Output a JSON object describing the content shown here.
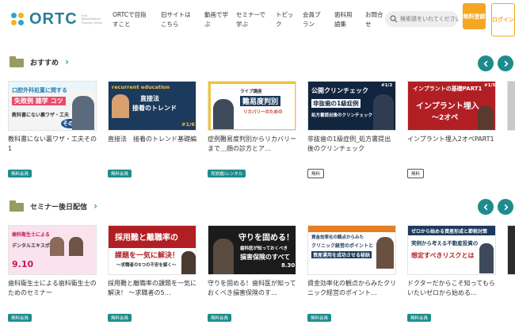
{
  "header": {
    "logo_text": "ORTC",
    "logo_sub": "Oral Rehabilitation Training Center",
    "nav": [
      {
        "label": "ORTCで目指すこと"
      },
      {
        "label": "旧サイトはこちら"
      },
      {
        "label": "動画で学ぶ"
      },
      {
        "label": "セミナーで学ぶ"
      },
      {
        "label": "トピック"
      },
      {
        "label": "会員プラン"
      },
      {
        "label": "歯科用語集"
      },
      {
        "label": "お問合せ"
      }
    ],
    "search_placeholder": "検索語をいれてください",
    "register_label": "無料登録",
    "login_label": "ログイン"
  },
  "sections": [
    {
      "title": "おすすめ",
      "cards": [
        {
          "title": "教科書にない裏ワザ・工夫その1",
          "badge": "無料会員",
          "badge_style": "green",
          "thumb": {
            "line1": "口腔外科処置に関する",
            "line2": "失敗例 雑学 コツ",
            "line3": "教科書にない裏ワザ・工夫",
            "tag": "その1"
          }
        },
        {
          "title": "直接法　接着のトレンド基礎編",
          "badge": "無料会員",
          "badge_style": "green",
          "thumb": {
            "line1": "recurrent education",
            "line2": "直接法",
            "line3": "接着のトレンド",
            "tag": "#1/6"
          }
        },
        {
          "title": "症例難易度判別からリカバリーまで＿顔の診方とア…",
          "badge": "見放題/レンタル",
          "badge_style": "green",
          "thumb": {
            "line1": "ライブ講座",
            "line2": "難易度判別",
            "line3": "リカバリーのための",
            "tag": ""
          }
        },
        {
          "title": "非抜歯の1級症例_処方書提出後のクリンチェック",
          "badge": "無料",
          "badge_style": "outline",
          "thumb": {
            "line1": "公開クリンチェック",
            "line2": "非抜歯の1級症例",
            "line3": "処方書提出後のクリンチェック",
            "tag": "#1/2"
          }
        },
        {
          "title": "インプラント埋入2オペPART1",
          "badge": "無料",
          "badge_style": "outline",
          "thumb": {
            "line1": "インプラントの基礎PART1",
            "line2": "インプラント埋入",
            "line3": "〜2オペ",
            "tag": "#1/5"
          }
        }
      ]
    },
    {
      "title": "セミナー後日配信",
      "cards": [
        {
          "title": "歯科衛生士による歯科衛生士のためのセミナー",
          "badge": "無料会員",
          "badge_style": "green",
          "thumb": {
            "line1": "歯科衛生士による",
            "line2": "デンタルエキスポ",
            "line3": "",
            "tag": "9.10"
          }
        },
        {
          "title": "採用難と離職率の課題を一気に解決！ 〜求職者の5…",
          "badge": "無料会員",
          "badge_style": "green",
          "thumb": {
            "line1": "採用難と離職率の",
            "line2": "課題を一気に解決！",
            "line3": "〜求職者の5つの不安を解く〜",
            "tag": ""
          }
        },
        {
          "title": "守りを固める！歯科医が知っておくべき損害保険のす…",
          "badge": "無料会員",
          "badge_style": "green",
          "thumb": {
            "line1": "守りを固める！",
            "line2": "歯科医が知っておくべき",
            "line3": "損害保険のすべて",
            "tag": "8.30"
          }
        },
        {
          "title": "資金効率化の観点からみたクリニック経営のポイント…",
          "badge": "無料会員",
          "badge_style": "green",
          "thumb": {
            "line1": "資金効率化の観点からみた",
            "line2": "クリニック経営のポイントと",
            "line3": "資産運用を成功させる秘訣",
            "tag": ""
          }
        },
        {
          "title": "ドクターだからこそ知ってもらいたいゼロから始める…",
          "badge": "無料会員",
          "badge_style": "green",
          "thumb": {
            "line1": "ゼロから始める資産形成と節税対策",
            "line2": "実例から考える不動産投資の",
            "line3": "想定すべきリスクとは",
            "tag": ""
          }
        }
      ]
    }
  ]
}
